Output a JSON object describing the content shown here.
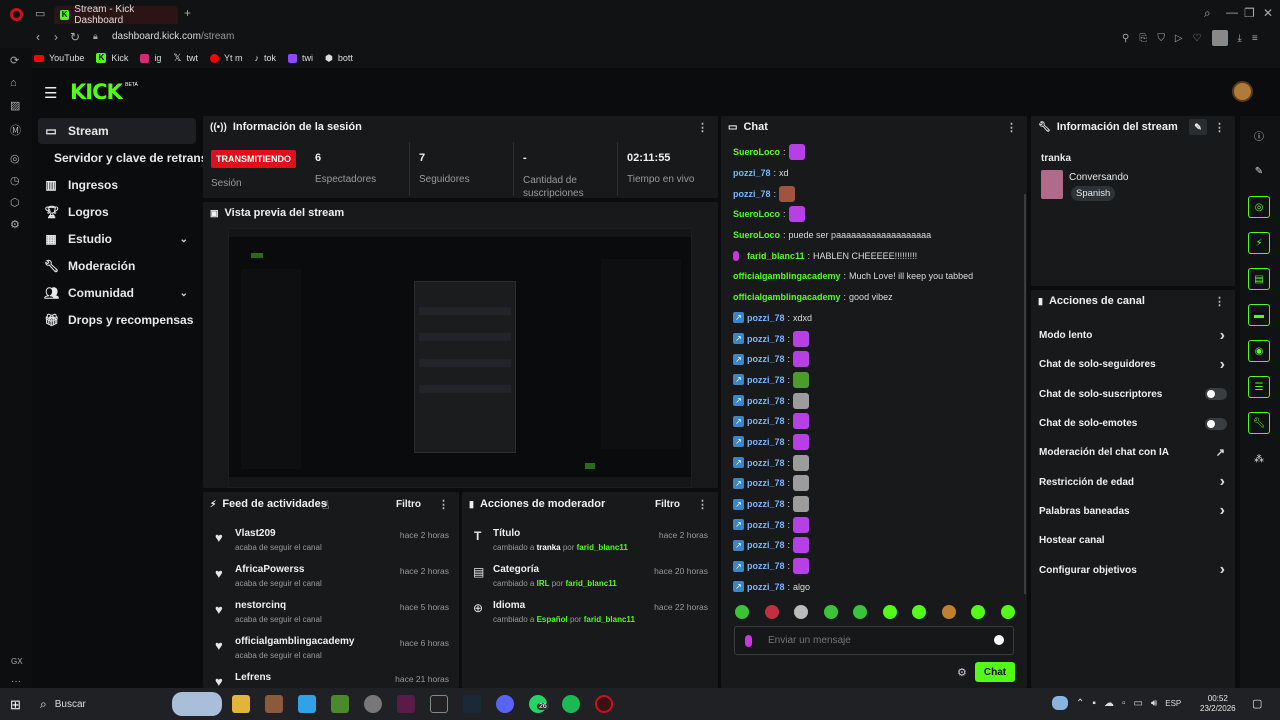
{
  "browser": {
    "tab_title": "Stream - Kick Dashboard",
    "url_host": "dashboard.kick.com",
    "url_path": "/stream",
    "bookmarks": [
      "YouTube",
      "Kick",
      "ig",
      "twt",
      "Yt m",
      "tok",
      "twi",
      "bott"
    ],
    "side_label": "GX"
  },
  "app": {
    "logo": "KICK",
    "logo_tag": "BETA",
    "accent": "#53fc18"
  },
  "nav": [
    {
      "label": "Stream",
      "icon": "video-icon"
    },
    {
      "label": "Servidor y clave de retransmisión",
      "icon": ""
    },
    {
      "label": "Ingresos",
      "icon": "chart-icon"
    },
    {
      "label": "Logros",
      "icon": "trophy-icon"
    },
    {
      "label": "Estudio",
      "icon": "grid-icon"
    },
    {
      "label": "Moderación",
      "icon": "wrench-icon"
    },
    {
      "label": "Comunidad",
      "icon": "people-icon"
    },
    {
      "label": "Drops y recompensas",
      "icon": "gift-icon"
    }
  ],
  "session": {
    "title": "Información de la sesión",
    "status": "TRANSMITIENDO",
    "status_label": "Sesión",
    "stats": [
      {
        "value": "6",
        "label": "Espectadores"
      },
      {
        "value": "7",
        "label": "Seguidores"
      },
      {
        "value": "-",
        "label": "Cantidad de suscripciones"
      },
      {
        "value": "02:11:55",
        "label": "Tiempo en vivo"
      }
    ]
  },
  "preview": {
    "title": "Vista previa del stream"
  },
  "feed": {
    "title": "Feed de actividades",
    "filter": "Filtro",
    "items": [
      {
        "name": "Vlast209",
        "action": "acaba de seguir el canal",
        "time": "hace 2 horas"
      },
      {
        "name": "AfricaPowerss",
        "action": "acaba de seguir el canal",
        "time": "hace 2 horas"
      },
      {
        "name": "nestorcinq",
        "action": "acaba de seguir el canal",
        "time": "hace 5 horas"
      },
      {
        "name": "officialgamblingacademy",
        "action": "acaba de seguir el canal",
        "time": "hace 6 horas"
      },
      {
        "name": "Lefrens",
        "action": "",
        "time": "hace 21 horas"
      }
    ]
  },
  "mod": {
    "title": "Acciones de moderador",
    "filter": "Filtro",
    "items": [
      {
        "title": "Título",
        "prefix": "cambiado a",
        "value": "tranka",
        "by": "por",
        "user": "farid_blanc11",
        "time": "hace 2 horas"
      },
      {
        "title": "Categoría",
        "prefix": "cambiado a",
        "value": "IRL",
        "by": "por",
        "user": "farid_blanc11",
        "time": "hace 20 horas"
      },
      {
        "title": "Idioma",
        "prefix": "cambiado a",
        "value": "Español",
        "by": "por",
        "user": "farid_blanc11",
        "time": "hace 22 horas"
      }
    ]
  },
  "chat": {
    "title": "Chat",
    "placeholder": "Enviar un mensaje",
    "send": "Chat",
    "messages": [
      {
        "user": "SueroLoco",
        "color": "#53fc18",
        "text": "",
        "emote": "#b640e6",
        "badge": false
      },
      {
        "user": "pozzi_78",
        "color": "#7ab7ff",
        "text": "xd",
        "emote": "",
        "badge": false
      },
      {
        "user": "pozzi_78",
        "color": "#7ab7ff",
        "text": "",
        "emote": "#a0543c",
        "badge": false
      },
      {
        "user": "SueroLoco",
        "color": "#53fc18",
        "text": "",
        "emote": "#b640e6",
        "badge": false
      },
      {
        "user": "SueroLoco",
        "color": "#53fc18",
        "text": "puede ser paaaaaaaaaaaaaaaaaaa",
        "emote": "",
        "badge": false
      },
      {
        "user": "farid_blanc11",
        "color": "#53fc18",
        "text": "HABLEN CHEEEEE!!!!!!!!!",
        "emote": "",
        "badge": false,
        "mic": true
      },
      {
        "user": "officialgamblingacademy",
        "color": "#53fc18",
        "text": "Much Love! ill keep you tabbed",
        "emote": "",
        "badge": false
      },
      {
        "user": "officialgamblingacademy",
        "color": "#53fc18",
        "text": "good vibez",
        "emote": "",
        "badge": false
      },
      {
        "user": "pozzi_78",
        "color": "#7ab7ff",
        "text": "xdxd",
        "emote": "",
        "badge": true
      },
      {
        "user": "pozzi_78",
        "color": "#7ab7ff",
        "text": "",
        "emote": "#b640e6",
        "badge": true
      },
      {
        "user": "pozzi_78",
        "color": "#7ab7ff",
        "text": "",
        "emote": "#b640e6",
        "badge": true
      },
      {
        "user": "pozzi_78",
        "color": "#7ab7ff",
        "text": "",
        "emote": "#4f9a2c",
        "badge": true
      },
      {
        "user": "pozzi_78",
        "color": "#7ab7ff",
        "text": "",
        "emote": "#9c9c9c",
        "badge": true
      },
      {
        "user": "pozzi_78",
        "color": "#7ab7ff",
        "text": "",
        "emote": "#b640e6",
        "badge": true
      },
      {
        "user": "pozzi_78",
        "color": "#7ab7ff",
        "text": "",
        "emote": "#b640e6",
        "badge": true
      },
      {
        "user": "pozzi_78",
        "color": "#7ab7ff",
        "text": "",
        "emote": "#9c9c9c",
        "badge": true
      },
      {
        "user": "pozzi_78",
        "color": "#7ab7ff",
        "text": "",
        "emote": "#9c9c9c",
        "badge": true
      },
      {
        "user": "pozzi_78",
        "color": "#7ab7ff",
        "text": "",
        "emote": "#9c9c9c",
        "badge": true
      },
      {
        "user": "pozzi_78",
        "color": "#7ab7ff",
        "text": "",
        "emote": "#b640e6",
        "badge": true
      },
      {
        "user": "pozzi_78",
        "color": "#7ab7ff",
        "text": "",
        "emote": "#b640e6",
        "badge": true
      },
      {
        "user": "pozzi_78",
        "color": "#7ab7ff",
        "text": "",
        "emote": "#b640e6",
        "badge": true
      },
      {
        "user": "pozzi_78",
        "color": "#7ab7ff",
        "text": "algo",
        "emote": "",
        "badge": true
      }
    ],
    "emote_colors": [
      "#3ac43a",
      "#c03040",
      "#bbbbbb",
      "#3ac43a",
      "#3ac43a",
      "#53fc18",
      "#53fc18",
      "#c08030",
      "#53fc18",
      "#53fc18"
    ]
  },
  "stream_info": {
    "title": "Información del stream",
    "stream_title": "tranka",
    "category": "Conversando",
    "language": "Spanish"
  },
  "channel_actions": {
    "title": "Acciones de canal",
    "items": [
      {
        "label": "Modo lento",
        "control": "arrow"
      },
      {
        "label": "Chat de solo-seguidores",
        "control": "arrow"
      },
      {
        "label": "Chat de solo-suscriptores",
        "control": "toggle"
      },
      {
        "label": "Chat de solo-emotes",
        "control": "toggle"
      },
      {
        "label": "Moderación del chat con IA",
        "control": "external"
      },
      {
        "label": "Restricción de edad",
        "control": "arrow"
      },
      {
        "label": "Palabras baneadas",
        "control": "arrow"
      },
      {
        "label": "Hostear canal",
        "control": "none"
      },
      {
        "label": "Configurar objetivos",
        "control": "arrow"
      }
    ]
  },
  "taskbar": {
    "search": "Buscar",
    "language": "ESP",
    "time": "00:52",
    "date": "23/2/2026",
    "whatsapp_count": "26"
  }
}
